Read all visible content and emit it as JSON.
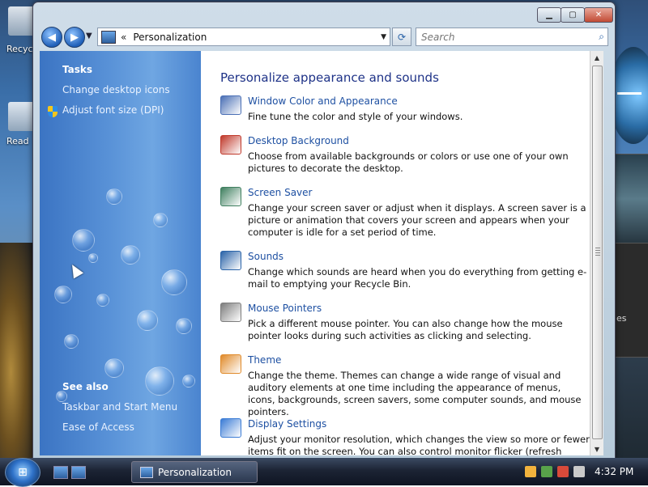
{
  "window": {
    "title": "Personalization"
  },
  "address": {
    "chevron": "«",
    "crumb": "Personalization"
  },
  "search": {
    "placeholder": "Search"
  },
  "left_pane": {
    "tasks_heading": "Tasks",
    "tasks": [
      "Change desktop icons",
      "Adjust font size (DPI)"
    ],
    "see_also_heading": "See also",
    "see_also": [
      "Taskbar and Start Menu",
      "Ease of Access"
    ]
  },
  "main": {
    "title": "Personalize appearance and sounds",
    "items": [
      {
        "label": "Window Color and Appearance",
        "desc": "Fine tune the color and style of your windows.",
        "icon": "window-color-icon",
        "color": "#4a6fb5"
      },
      {
        "label": "Desktop Background",
        "desc": "Choose from available backgrounds or colors or use one of your own pictures to decorate the desktop.",
        "icon": "desktop-background-icon",
        "color": "#c0392b"
      },
      {
        "label": "Screen Saver",
        "desc": "Change your screen saver or adjust when it displays. A screen saver is a picture or animation that covers your screen and appears when your computer is idle for a set period of time.",
        "icon": "screen-saver-icon",
        "color": "#3f7f5f"
      },
      {
        "label": "Sounds",
        "desc": "Change which sounds are heard when you do everything from getting e-mail to emptying your Recycle Bin.",
        "icon": "sounds-icon",
        "color": "#2a63a8"
      },
      {
        "label": "Mouse Pointers",
        "desc": "Pick a different mouse pointer. You can also change how the mouse pointer looks during such activities as clicking and selecting.",
        "icon": "mouse-pointer-icon",
        "color": "#7d7d7d"
      },
      {
        "label": "Theme",
        "desc": "Change the theme. Themes can change a wide range of visual and auditory elements at one time including the appearance of menus, icons, backgrounds, screen savers, some computer sounds, and mouse pointers.",
        "icon": "theme-icon",
        "color": "#e08a2a"
      },
      {
        "label": "Display Settings",
        "desc": "Adjust your monitor resolution, which changes the view so more or fewer items fit on the screen. You can also control monitor flicker (refresh rate).",
        "icon": "display-settings-icon",
        "color": "#3a7bd5"
      }
    ]
  },
  "desktop": {
    "icons": [
      "Recyc",
      "Read"
    ],
    "gadget_text": "es"
  },
  "taskbar": {
    "task_label": "Personalization",
    "time": "4:32 PM"
  },
  "colors": {
    "link": "#1e50a2",
    "title": "#1e3287",
    "left_pane": "#4a84cf"
  }
}
